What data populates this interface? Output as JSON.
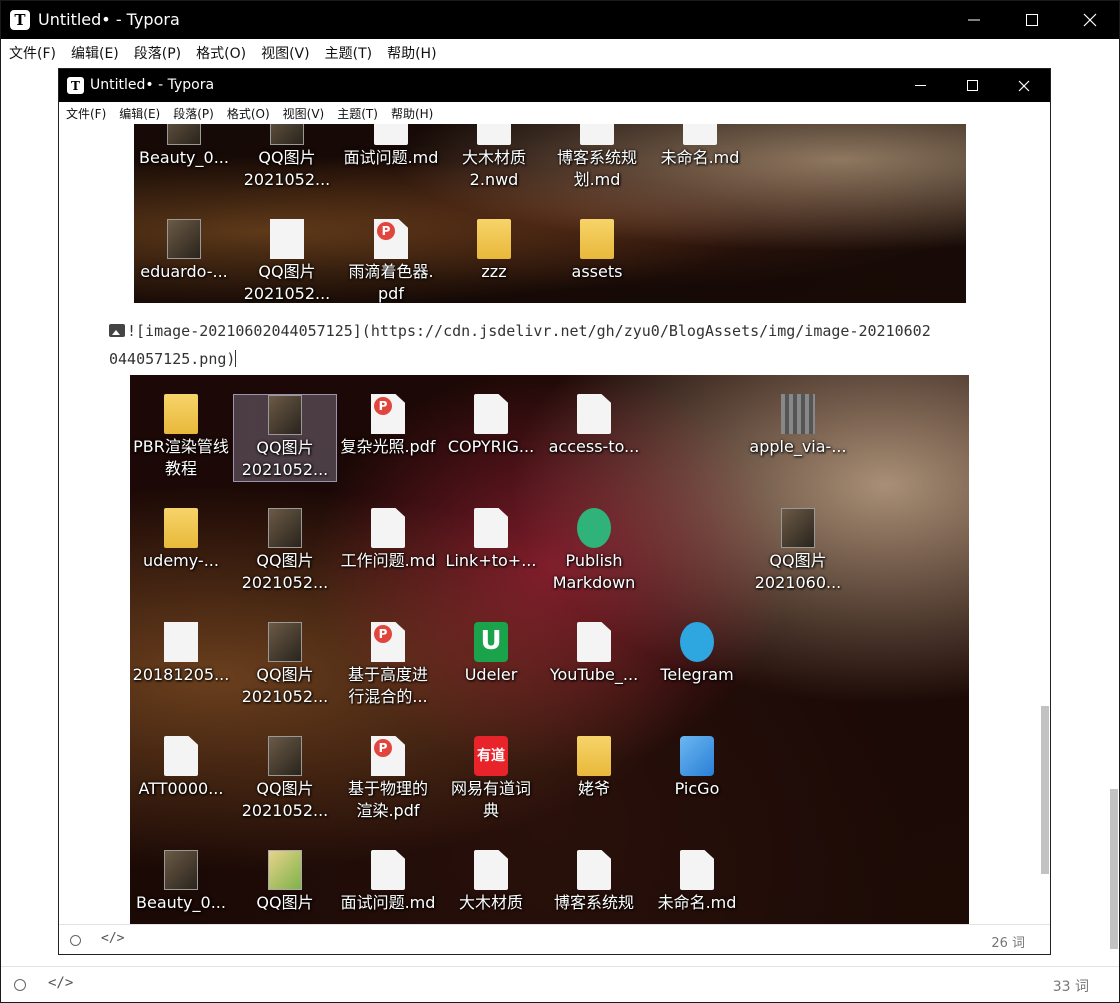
{
  "outer": {
    "title": "Untitled• - Typora",
    "menu": [
      "文件(F)",
      "编辑(E)",
      "段落(P)",
      "格式(O)",
      "视图(V)",
      "主题(T)",
      "帮助(H)"
    ],
    "word_count": "33 词",
    "code_toggle": "</>"
  },
  "inner": {
    "title": "Untitled• - Typora",
    "menu": [
      "文件(F)",
      "编辑(E)",
      "段落(P)",
      "格式(O)",
      "视图(V)",
      "主题(T)",
      "帮助(H)"
    ],
    "word_count": "26 词",
    "code_toggle": "</>"
  },
  "app_icon_letter": "T",
  "source_line_1": "![image-20210602044057125](https://cdn.jsdelivr.net/gh/zyu0/BlogAssets/img/image-20210602",
  "source_line_2": "044057125.png)",
  "top_image_icons": [
    {
      "label": "Beauty_0...",
      "glyph": "photo"
    },
    {
      "label": "QQ图片\n2021052...",
      "glyph": "photo"
    },
    {
      "label": "面试问题.md",
      "glyph": "file"
    },
    {
      "label": "大木材质\n2.nwd",
      "glyph": "file"
    },
    {
      "label": "博客系统规\n划.md",
      "glyph": "file"
    },
    {
      "label": "未命名.md",
      "glyph": "file"
    },
    {
      "label": "eduardo-...",
      "glyph": "photo"
    },
    {
      "label": "QQ图片\n2021052...",
      "glyph": "narrow"
    },
    {
      "label": "雨滴着色器.\npdf",
      "glyph": "pdf"
    },
    {
      "label": "zzz",
      "glyph": "folder"
    },
    {
      "label": "assets",
      "glyph": "folder"
    }
  ],
  "bottom_image_icons": [
    {
      "label": "PBR渲染管线\n教程",
      "glyph": "folder"
    },
    {
      "label": "QQ图片\n2021052...",
      "glyph": "photo",
      "selected": true
    },
    {
      "label": "复杂光照.pdf",
      "glyph": "pdf"
    },
    {
      "label": "COPYRIG...",
      "glyph": "file"
    },
    {
      "label": "access-to...",
      "glyph": "file"
    },
    {
      "label": "apple_via-...",
      "glyph": "grid"
    },
    {
      "label": "udemy-...",
      "glyph": "folder"
    },
    {
      "label": "QQ图片\n2021052...",
      "glyph": "photo"
    },
    {
      "label": "工作问题.md",
      "glyph": "file"
    },
    {
      "label": "Link+to+...",
      "glyph": "file"
    },
    {
      "label": "Publish\nMarkdown",
      "glyph": "publish"
    },
    {
      "label": "QQ图片\n2021060...",
      "glyph": "photo"
    },
    {
      "label": "20181205...",
      "glyph": "narrow"
    },
    {
      "label": "QQ图片\n2021052...",
      "glyph": "photo"
    },
    {
      "label": "基于高度进\n行混合的...",
      "glyph": "pdf"
    },
    {
      "label": "Udeler",
      "glyph": "udeler"
    },
    {
      "label": "YouTube_...",
      "glyph": "file"
    },
    {
      "label": "Telegram",
      "glyph": "telegram"
    },
    {
      "label": "ATT0000...",
      "glyph": "file"
    },
    {
      "label": "QQ图片\n2021052...",
      "glyph": "photo"
    },
    {
      "label": "基于物理的\n渲染.pdf",
      "glyph": "pdf"
    },
    {
      "label": "网易有道词\n典",
      "glyph": "youdao"
    },
    {
      "label": "姥爷",
      "glyph": "folder"
    },
    {
      "label": "PicGo",
      "glyph": "picgo"
    },
    {
      "label": "Beauty_0...",
      "glyph": "photo"
    },
    {
      "label": "QQ图片",
      "glyph": "frog"
    },
    {
      "label": "面试问题.md",
      "glyph": "file"
    },
    {
      "label": "大木材质",
      "glyph": "file"
    },
    {
      "label": "博客系统规",
      "glyph": "file"
    },
    {
      "label": "未命名.md",
      "glyph": "file"
    }
  ],
  "youdao_glyph_text": "有道",
  "udeler_glyph_text": "U"
}
